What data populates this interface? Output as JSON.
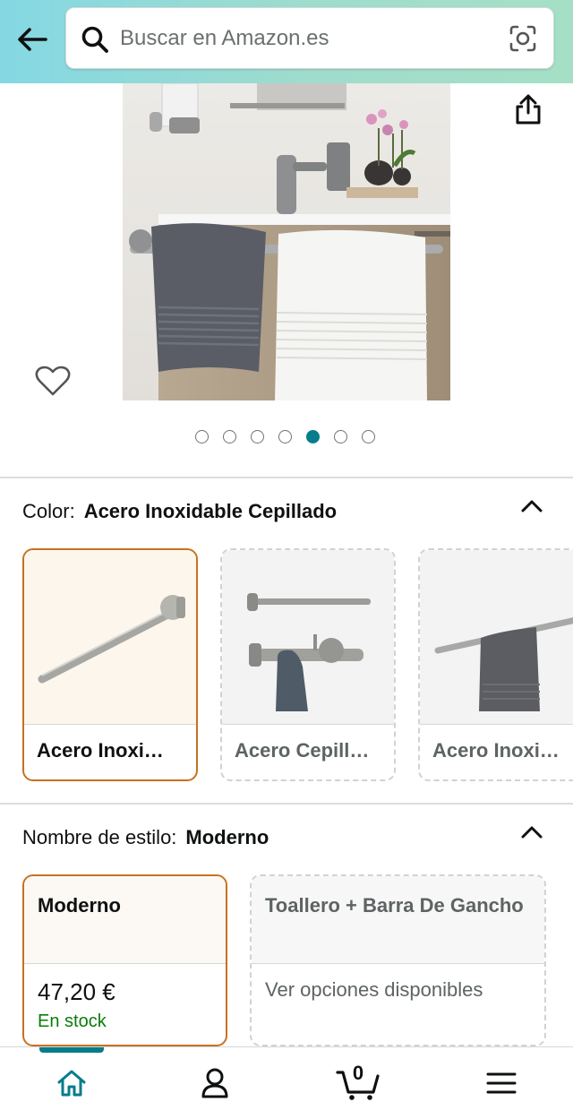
{
  "header": {
    "search_placeholder": "Buscar en Amazon.es",
    "back_icon": "arrow-left-icon",
    "search_icon": "magnifier-icon",
    "camera_icon": "camera-lens-icon"
  },
  "gallery": {
    "image_count": 7,
    "active_index": 4,
    "share_icon": "share-icon",
    "wishlist_icon": "heart-icon"
  },
  "color_section": {
    "label": "Color:",
    "selected_value": "Acero Inoxidable Cepillado",
    "options": [
      {
        "label": "Acero Inoxi…",
        "selected": true
      },
      {
        "label": "Acero Cepill…",
        "selected": false
      },
      {
        "label": "Acero Inoxi…",
        "selected": false
      }
    ]
  },
  "style_section": {
    "label": "Nombre de estilo:",
    "selected_value": "Moderno",
    "options": [
      {
        "title": "Moderno",
        "price": "47,20 €",
        "stock": "En stock",
        "selected": true
      },
      {
        "title": "Toallero + Barra De Gancho",
        "detail": "Ver opciones disponibles",
        "selected": false
      }
    ]
  },
  "bottom_nav": {
    "items": [
      "home-icon",
      "account-icon",
      "cart-icon",
      "menu-icon"
    ],
    "cart_count": "0"
  },
  "colors": {
    "accent": "#067d8b",
    "selected_border": "#c7711f",
    "in_stock": "#0a7c0a"
  }
}
